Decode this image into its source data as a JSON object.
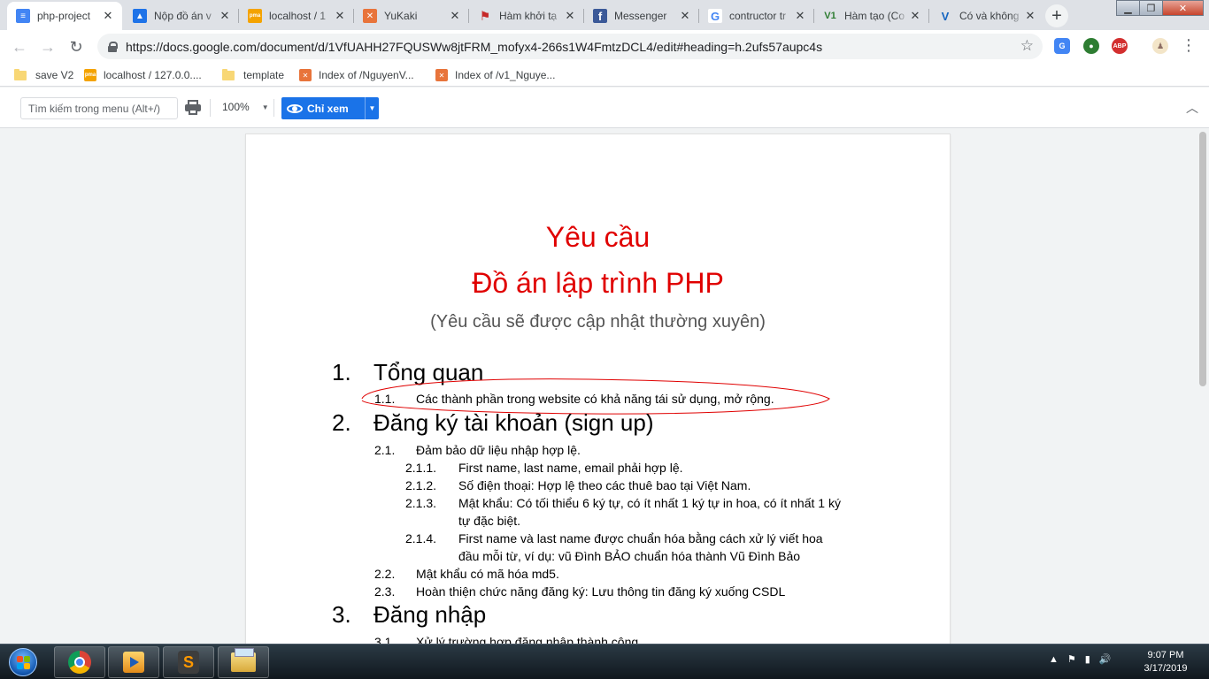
{
  "browser": {
    "tabs": [
      {
        "title": "php-project",
        "icon": "google-docs-icon",
        "color": "#4285f4",
        "glyph": "≡",
        "active": true
      },
      {
        "title": "Nộp đồ án v",
        "icon": "classroom-icon",
        "color": "#1e73e8",
        "glyph": "▲"
      },
      {
        "title": "localhost / 1",
        "icon": "phpmyadmin-icon",
        "color": "#f4a300",
        "glyph": "pma"
      },
      {
        "title": "YuKaki",
        "icon": "xampp-icon",
        "color": "#e8743b",
        "glyph": "✕"
      },
      {
        "title": "Hàm khởi tạ",
        "icon": "flag-icon",
        "color": "#c62828",
        "glyph": "⚑"
      },
      {
        "title": "Messenger",
        "icon": "facebook-icon",
        "color": "#3b5998",
        "glyph": "f"
      },
      {
        "title": "contructor tr",
        "icon": "google-icon",
        "color": "#ffffff",
        "glyph": "G"
      },
      {
        "title": "Hàm tạo (Co",
        "icon": "v1-icon",
        "color": "#ffffff",
        "glyph": "V1"
      },
      {
        "title": "Có và không",
        "icon": "v-icon",
        "color": "#ffffff",
        "glyph": "V"
      }
    ],
    "url": "https://docs.google.com/document/d/1VfUAHH27FQUSWw8jtFRM_mofyx4-266s1W4FmtzDCL4/edit#heading=h.2ufs57aupc4s",
    "bookmarks": [
      {
        "label": "save V2",
        "icon": "folder-icon"
      },
      {
        "label": "localhost / 127.0.0....",
        "icon": "phpmyadmin-icon"
      },
      {
        "label": "template",
        "icon": "folder-icon"
      },
      {
        "label": "Index of /NguyenV...",
        "icon": "xampp-icon"
      },
      {
        "label": "Index of /v1_Nguye...",
        "icon": "xampp-icon"
      }
    ]
  },
  "docs_toolbar": {
    "menu_search_placeholder": "Tìm kiếm trong menu (Alt+/)",
    "zoom": "100%",
    "mode_label": "Chỉ xem"
  },
  "document": {
    "title_line1": "Yêu cầu",
    "title_line2": "Đồ án lập trình PHP",
    "subtitle": "(Yêu cầu sẽ được cập nhật thường xuyên)",
    "sections": [
      {
        "num": "1.",
        "title": "Tổng quan"
      },
      {
        "num": "2.",
        "title": "Đăng ký tài khoản (sign up)"
      },
      {
        "num": "3.",
        "title": "Đăng nhập"
      }
    ],
    "items": [
      {
        "num": "1.1.",
        "text": "Các thành phần trong website có khả năng tái sử dụng, mở rộng."
      },
      {
        "num": "2.1.",
        "text": "Đảm bảo dữ liệu nhập hợp lệ."
      },
      {
        "num": "2.1.1.",
        "text": "First name, last name, email phải hợp lệ."
      },
      {
        "num": "2.1.2.",
        "text": "Số điện thoại: Hợp lệ theo các thuê bao tại Việt Nam."
      },
      {
        "num": "2.1.3.",
        "text": "Mật khẩu: Có tối thiểu 6 ký tự, có ít nhất 1 ký tự in hoa, có ít nhất 1 ký",
        "text2": "tự đặc biệt."
      },
      {
        "num": "2.1.4.",
        "text": "First name và last name được chuẩn hóa bằng cách xử lý viết hoa",
        "text2": "đầu mỗi từ, ví dụ: vũ Đình BẢO chuẩn hóa thành Vũ Đình Bảo"
      },
      {
        "num": "2.2.",
        "text": "Mật khẩu có mã hóa md5."
      },
      {
        "num": "2.3.",
        "text": "Hoàn thiện chức năng đăng ký: Lưu thông tin đăng ký xuống CSDL"
      },
      {
        "num": "3.1.",
        "text": "Xử lý trường hợp đăng nhập thành công."
      }
    ],
    "title_color": "#e00000"
  },
  "taskbar": {
    "apps": [
      "chrome-icon",
      "media-player-icon",
      "sublime-text-icon",
      "file-explorer-icon"
    ],
    "time": "9:07 PM",
    "date": "3/17/2019"
  }
}
